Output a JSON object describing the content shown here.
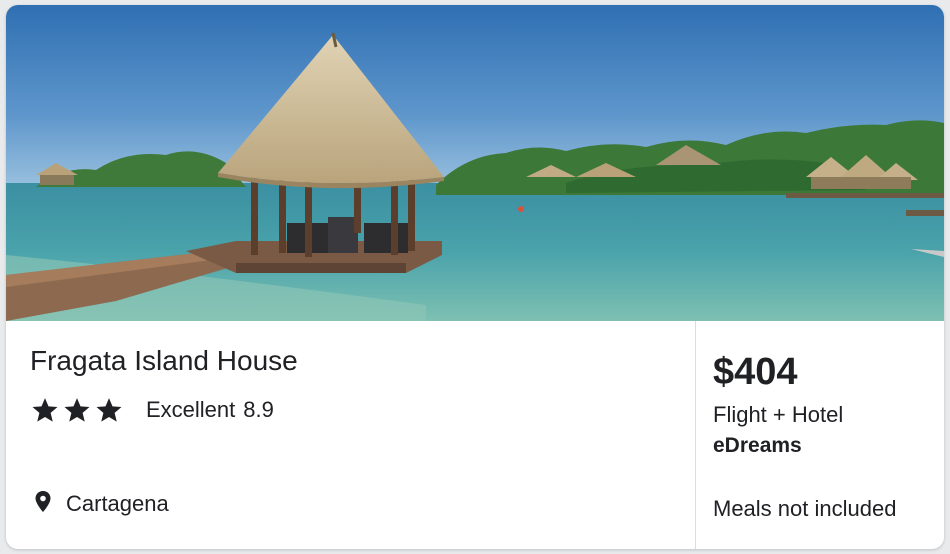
{
  "hotel": {
    "name": "Fragata Island House",
    "star_count": 3,
    "rating_label": "Excellent",
    "rating_score": "8.9",
    "location": "Cartagena",
    "image_icon": "thatched-gazebo-over-water-photo"
  },
  "offer": {
    "price": "$404",
    "package": "Flight + Hotel",
    "provider": "eDreams",
    "meals": "Meals not included"
  },
  "icons": {
    "star": "star-icon",
    "location": "map-pin-icon"
  },
  "colors": {
    "text": "#202124",
    "divider": "#dadce0",
    "card_background": "#ffffff"
  }
}
